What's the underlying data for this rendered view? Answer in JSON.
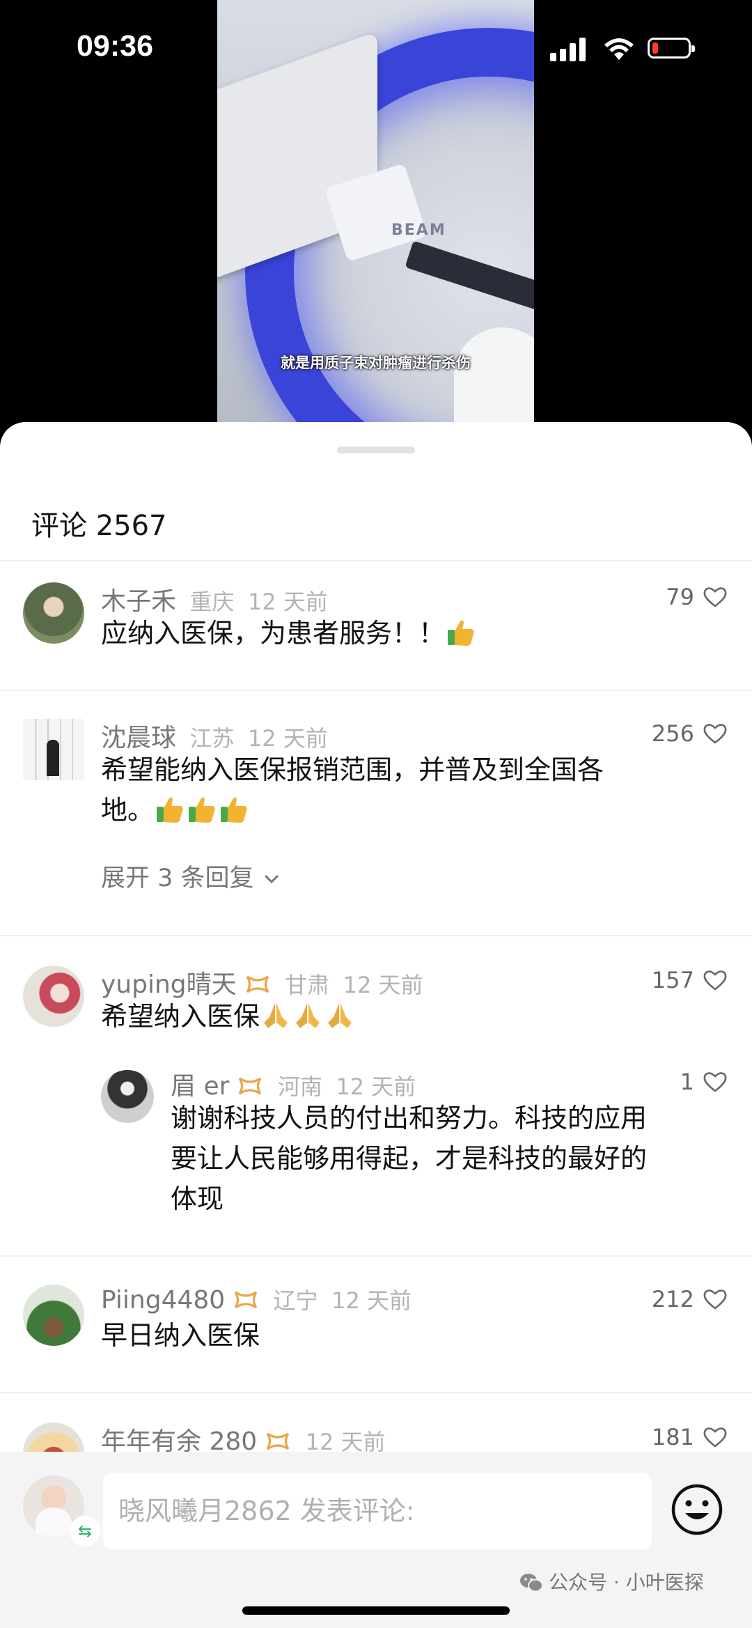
{
  "status_bar": {
    "time": "09:36"
  },
  "video": {
    "subtitle": "就是用质子束对肿瘤进行杀伤",
    "machine_label": "BEAM"
  },
  "sheet": {
    "title": "评论 2567"
  },
  "comments": [
    {
      "user": "木子禾",
      "location": "重庆",
      "time": "12 天前",
      "likes": "79",
      "text": "应纳入医保，为患者服务！！",
      "emoji_count": 1
    },
    {
      "user": "沈晨球",
      "location": "江苏",
      "time": "12 天前",
      "likes": "256",
      "text_line1": "希望能纳入医保报销范围，并普及到全国各",
      "text_line2": "地。",
      "emoji_count": 3,
      "expand": "展开 3 条回复"
    },
    {
      "user": "yuping晴天",
      "location": "甘肃",
      "time": "12 天前",
      "likes": "157",
      "text": "希望纳入医保",
      "emoji_count": 3,
      "reply": {
        "user": "眉 er",
        "location": "河南",
        "time": "12 天前",
        "likes": "1",
        "lines": [
          "谢谢科技人员的付出和努力。科技的应用",
          "要让人民能够用得起，才是科技的最好的",
          "体现"
        ]
      }
    },
    {
      "user": "Piing4480",
      "location": "辽宁",
      "time": "12 天前",
      "likes": "212",
      "text": "早日纳入医保"
    },
    {
      "user": "年年有余 280",
      "location": "",
      "time": "12 天前",
      "likes": "181"
    }
  ],
  "bottom_bar": {
    "placeholder": "晓风曦月2862 发表评论:",
    "watermark": "公众号 · 小叶医探"
  },
  "colors": {
    "badge": "#e8a64a",
    "thumb": "#f2b233",
    "prayer": "#e9a93c",
    "wechat_green": "#2fb36a"
  }
}
